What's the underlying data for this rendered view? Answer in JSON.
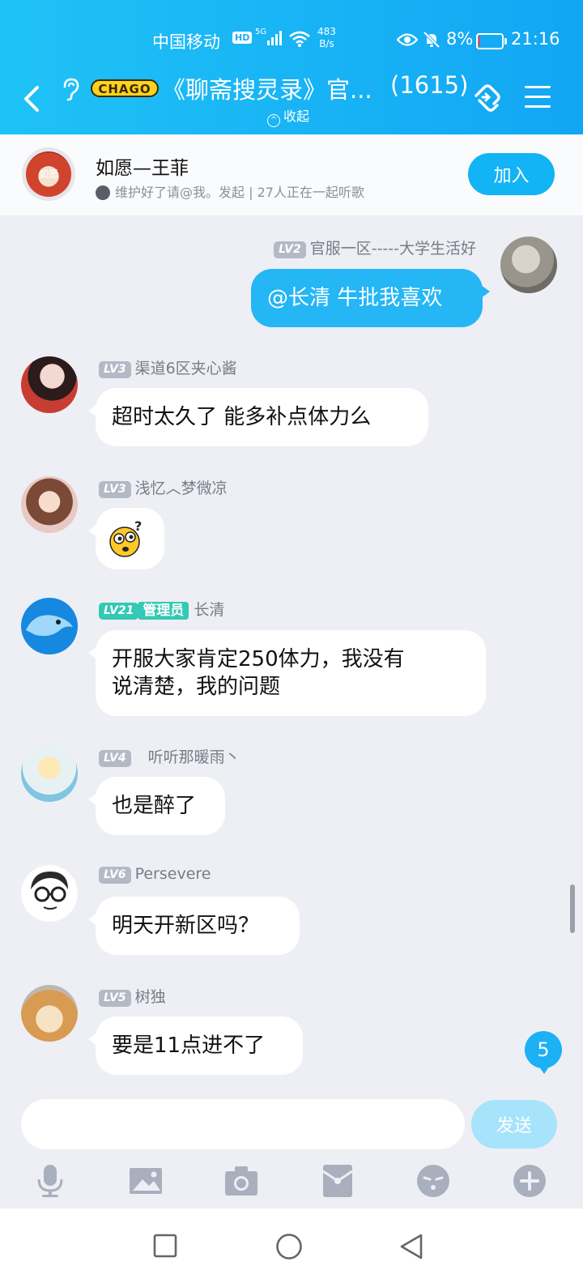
{
  "status": {
    "carrier": "中国移动",
    "hd": "HD",
    "network": "5G",
    "speed_value": "483",
    "speed_unit": "B/s",
    "battery": "8%",
    "time": "21:16"
  },
  "nav": {
    "logo": "CHAGO",
    "title": "《聊斋搜灵录》官...",
    "member_count": "(1615)",
    "collapse": "收起"
  },
  "music": {
    "disc_text": "如愿",
    "song": "如愿—王菲",
    "info": "维护好了请@我。发起 | 27人正在一起听歌",
    "join": "加入"
  },
  "messages": [
    {
      "level": "LV2",
      "name": "官服一区-----大学生活好",
      "text": "@长清 牛批我喜欢",
      "mine": true
    },
    {
      "level": "LV3",
      "name": "渠道6区夹心酱",
      "text": "超时太久了 能多补点体力么"
    },
    {
      "level": "LV3",
      "name": "浅忆︿梦微凉",
      "text": "",
      "emoji": true
    },
    {
      "level": "LV21",
      "role": "管理员",
      "name": "长清",
      "text_line1": "开服大家肯定250体力，我没有",
      "text_line2": "说清楚，我的问题"
    },
    {
      "level": "LV4",
      "name": "听听那暖雨丶",
      "text": "也是醉了"
    },
    {
      "level": "LV6",
      "name": "Persevere",
      "text": "明天开新区吗？"
    },
    {
      "level": "LV5",
      "name": "树独",
      "text": "要是11点进不了"
    }
  ],
  "new_messages": "5",
  "input": {
    "placeholder": "",
    "send": "发送"
  },
  "colors": {
    "header": "#12a6f4",
    "accent": "#24b6f5",
    "admin": "#33c9b4"
  }
}
